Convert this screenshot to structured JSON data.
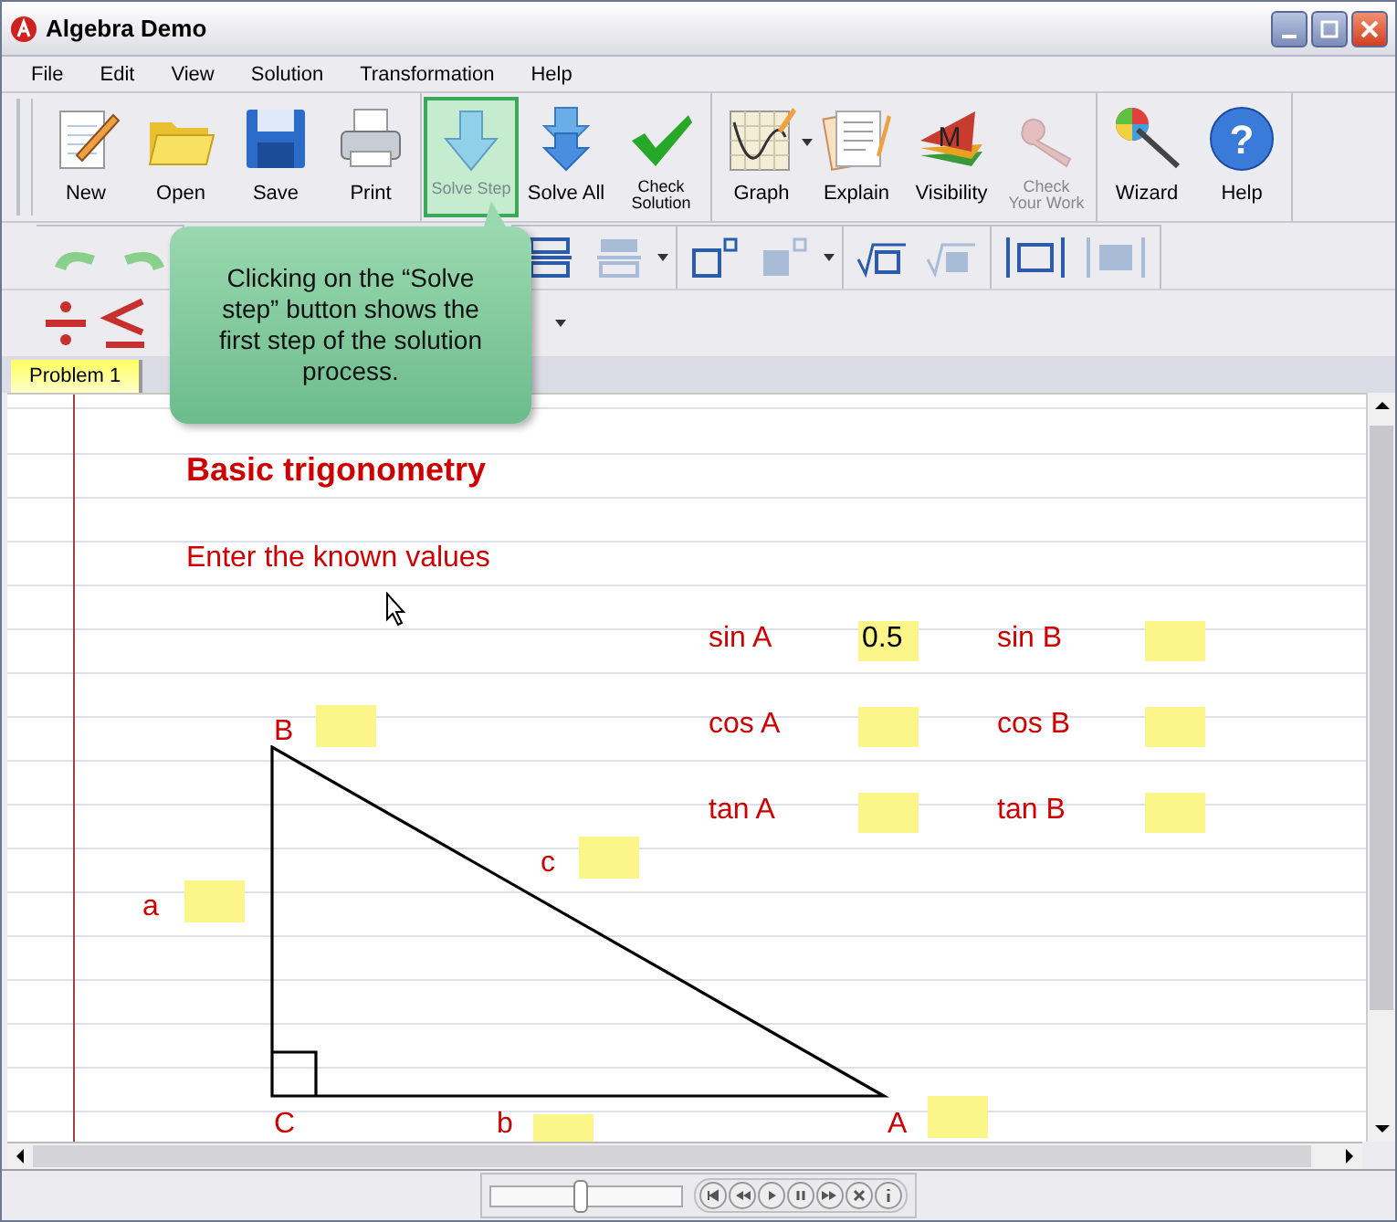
{
  "window": {
    "title": "Algebra Demo"
  },
  "menu": [
    {
      "label": "File"
    },
    {
      "label": "Edit"
    },
    {
      "label": "View"
    },
    {
      "label": "Solution"
    },
    {
      "label": "Transformation"
    },
    {
      "label": "Help"
    }
  ],
  "toolbar": {
    "groups": [
      [
        {
          "label": "New",
          "kind": "large",
          "highlighted": false,
          "disabled": false
        },
        {
          "label": "Open",
          "kind": "large",
          "highlighted": false,
          "disabled": false
        },
        {
          "label": "Save",
          "kind": "large",
          "highlighted": false,
          "disabled": false
        },
        {
          "label": "Print",
          "kind": "large",
          "highlighted": false,
          "disabled": false
        }
      ],
      [
        {
          "label": "Solve Step",
          "kind": "compact",
          "highlighted": true,
          "disabled": false
        },
        {
          "label": "Solve All",
          "kind": "large",
          "highlighted": false,
          "disabled": false
        },
        {
          "label": "Check Solution",
          "kind": "compact",
          "highlighted": false,
          "disabled": false
        }
      ],
      [
        {
          "label": "Graph",
          "kind": "large",
          "highlighted": false,
          "disabled": false,
          "dropdown": true
        },
        {
          "label": "Explain",
          "kind": "large",
          "highlighted": false,
          "disabled": false
        },
        {
          "label": "Visibility",
          "kind": "large",
          "highlighted": false,
          "disabled": false,
          "icon_text": "M"
        },
        {
          "label": "Check Your Work",
          "kind": "compact",
          "highlighted": false,
          "disabled": true
        }
      ],
      [
        {
          "label": "Wizard",
          "kind": "large",
          "highlighted": false,
          "disabled": false
        },
        {
          "label": "Help",
          "kind": "large",
          "highlighted": false,
          "disabled": false,
          "icon_text": "?"
        }
      ]
    ]
  },
  "callout": {
    "text": "Clicking on the “Solve step” button shows the first step of the solution process."
  },
  "tabs": [
    {
      "label": "Problem 1",
      "selected": true
    }
  ],
  "worksheet": {
    "title": "Basic trigonometry",
    "instruction": "Enter the known values",
    "trig_fields": [
      {
        "label": "sin A",
        "value": "0.5"
      },
      {
        "label": "sin B"
      },
      {
        "label": "cos A"
      },
      {
        "label": "cos B"
      },
      {
        "label": "tan A"
      },
      {
        "label": "tan B"
      }
    ],
    "triangle": {
      "labels": [
        {
          "text": "B",
          "has_field": true
        },
        {
          "text": "c",
          "has_field": true
        },
        {
          "text": "a",
          "has_field": true
        },
        {
          "text": "C",
          "has_field": false
        },
        {
          "text": "b",
          "has_field": true
        },
        {
          "text": "A",
          "has_field": true
        }
      ]
    }
  },
  "player": {
    "level": 0.46
  }
}
